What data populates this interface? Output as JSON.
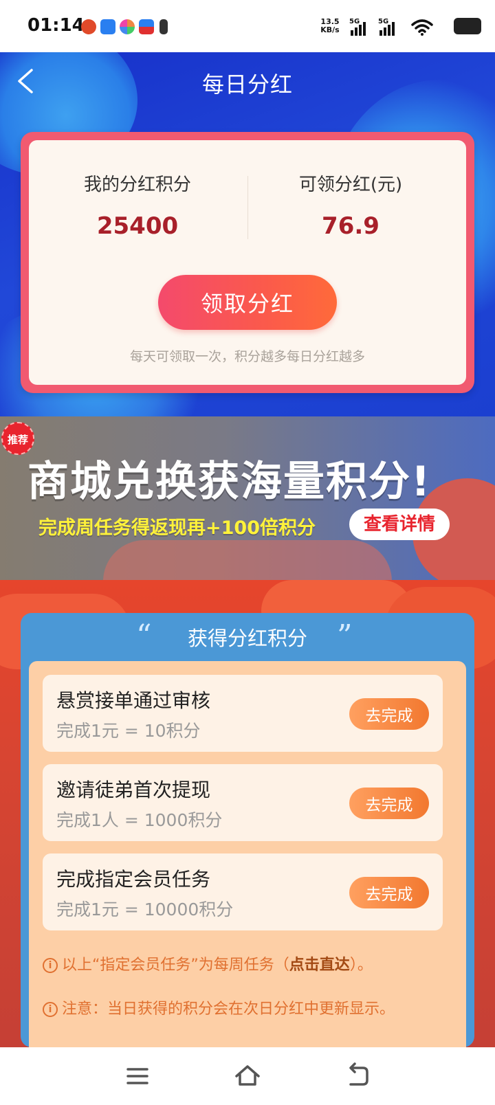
{
  "status_bar": {
    "time": "01:14",
    "net_speed_value": "13.5",
    "net_speed_unit": "KB/s",
    "signal_1": "5G",
    "signal_2": "5G"
  },
  "header": {
    "title": "每日分红",
    "back_icon": "back-arrow-icon"
  },
  "dividend_card": {
    "points_label": "我的分红积分",
    "points_value": "25400",
    "cash_label": "可领分红(元)",
    "cash_value": "76.9",
    "claim_button": "领取分红",
    "note": "每天可领取一次，积分越多每日分红越多"
  },
  "banner": {
    "badge": "推荐",
    "title": "商城兑换获海量积分!",
    "subtitle": "完成周任务得返现再+100倍积分",
    "detail_button": "查看详情"
  },
  "tasks": {
    "title": "获得分红积分",
    "items": [
      {
        "title": "悬赏接单通过审核",
        "desc": "完成1元 = 10积分",
        "button": "去完成"
      },
      {
        "title": "邀请徒弟首次提现",
        "desc": "完成1人 = 1000积分",
        "button": "去完成"
      },
      {
        "title": "完成指定会员任务",
        "desc": "完成1元 = 10000积分",
        "button": "去完成"
      }
    ],
    "note_1_prefix": "以上“指定会员任务”为每周任务（",
    "note_1_link": "点击直达",
    "note_1_suffix": "）。",
    "note_2": "注意：当日获得的积分会在次日分红中更新显示。"
  },
  "nav_bar": {
    "icons": [
      "menu-icon",
      "home-icon",
      "back-icon"
    ]
  }
}
